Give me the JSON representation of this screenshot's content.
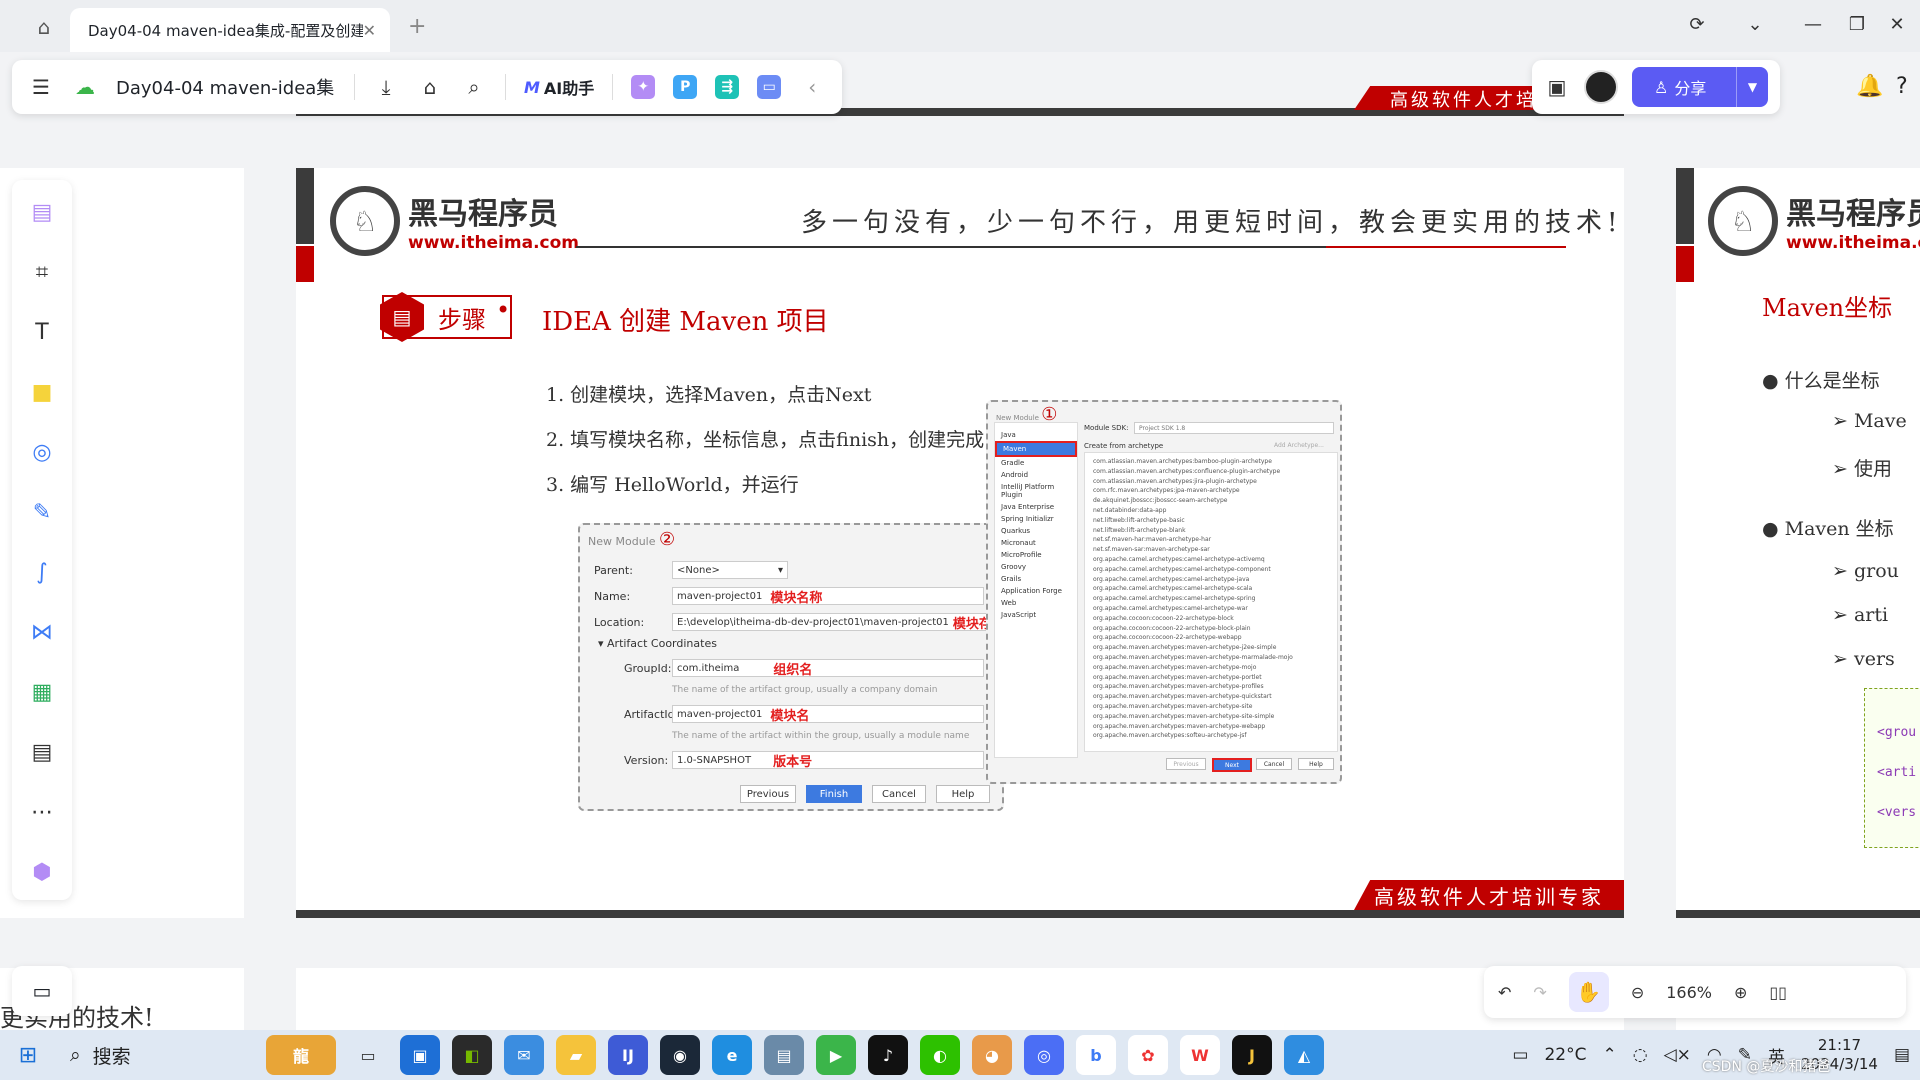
{
  "browser": {
    "tab_title": "Day04-04 maven-idea集成-配置及创建",
    "close_glyph": "✕",
    "new_tab_glyph": "+",
    "controls": [
      "⟳",
      "⌄",
      "—",
      "❐",
      "✕"
    ]
  },
  "toolbar": {
    "menu_glyph": "☰",
    "doc_title": "Day04-04 maven-idea集...",
    "ai_label": "AI助手",
    "collapse_glyph": "‹"
  },
  "right_toolbar": {
    "share_label": "分享"
  },
  "slide": {
    "logo_name": "黑马程序员",
    "logo_url": "www.itheima.com",
    "motto": "多一句没有，少一句不行，用更短时间，教会更实用的技术!",
    "step_label": "步骤",
    "heading": "IDEA 创建 Maven 项目",
    "bullet": "•",
    "steps": [
      "1.  创建模块，选择Maven，点击Next",
      "2.  填写模块名称，坐标信息，点击finish，创建完成",
      "3.  编写 HelloWorld，并运行"
    ],
    "footer": "高级软件人才培训专家"
  },
  "dialog2": {
    "title": "New Module",
    "number": "②",
    "parent_label": "Parent:",
    "parent_value": "<None>",
    "name_label": "Name:",
    "name_value": "maven-project01",
    "name_note": "模块名称",
    "location_label": "Location:",
    "location_value": "E:\\develop\\itheima-db-dev-project01\\maven-project01",
    "location_note": "模块存放路径",
    "section": "▾ Artifact Coordinates",
    "groupid_label": "GroupId:",
    "groupid_value": "com.itheima",
    "groupid_note": "组织名",
    "groupid_hint": "The name of the artifact group, usually a company domain",
    "artifactid_label": "ArtifactId:",
    "artifactid_value": "maven-project01",
    "artifactid_note": "模块名",
    "artifactid_hint": "The name of the artifact within the group, usually a module name",
    "version_label": "Version:",
    "version_value": "1.0-SNAPSHOT",
    "version_note": "版本号",
    "buttons": [
      "Previous",
      "Finish",
      "Cancel",
      "Help"
    ]
  },
  "dialog1": {
    "title": "New Module",
    "number": "①",
    "sdk_label": "Module SDK:",
    "sdk_value": "Project SDK 1.8",
    "archetype_checkbox": "Create from archetype",
    "add_archetype": "Add Archetype...",
    "side_items": [
      "Java",
      "Maven",
      "Gradle",
      "Android",
      "IntelliJ Platform Plugin",
      "Java Enterprise",
      "Spring Initializr",
      "Quarkus",
      "Micronaut",
      "MicroProfile",
      "Groovy",
      "Grails",
      "Application Forge",
      "Web",
      "JavaScript"
    ],
    "archetypes": [
      "com.atlassian.maven.archetypes:bamboo-plugin-archetype",
      "com.atlassian.maven.archetypes:confluence-plugin-archetype",
      "com.atlassian.maven.archetypes:jira-plugin-archetype",
      "com.rfc.maven.archetypes:jpa-maven-archetype",
      "de.akquinet.jbosscc:jbosscc-seam-archetype",
      "net.databinder:data-app",
      "net.liftweb:lift-archetype-basic",
      "net.liftweb:lift-archetype-blank",
      "net.sf.maven-har:maven-archetype-har",
      "net.sf.maven-sar:maven-archetype-sar",
      "org.apache.camel.archetypes:camel-archetype-activemq",
      "org.apache.camel.archetypes:camel-archetype-component",
      "org.apache.camel.archetypes:camel-archetype-java",
      "org.apache.camel.archetypes:camel-archetype-scala",
      "org.apache.camel.archetypes:camel-archetype-spring",
      "org.apache.camel.archetypes:camel-archetype-war",
      "org.apache.cocoon:cocoon-22-archetype-block",
      "org.apache.cocoon:cocoon-22-archetype-block-plain",
      "org.apache.cocoon:cocoon-22-archetype-webapp",
      "org.apache.maven.archetypes:maven-archetype-j2ee-simple",
      "org.apache.maven.archetypes:maven-archetype-marmalade-mojo",
      "org.apache.maven.archetypes:maven-archetype-mojo",
      "org.apache.maven.archetypes:maven-archetype-portlet",
      "org.apache.maven.archetypes:maven-archetype-profiles",
      "org.apache.maven.archetypes:maven-archetype-quickstart",
      "org.apache.maven.archetypes:maven-archetype-site",
      "org.apache.maven.archetypes:maven-archetype-site-simple",
      "org.apache.maven.archetypes:maven-archetype-webapp",
      "org.apache.maven.archetypes:softeu-archetype-jsf"
    ],
    "buttons": [
      "Previous",
      "Next",
      "Cancel",
      "Help"
    ]
  },
  "right_slide": {
    "logo_name": "黑马程序员",
    "logo_url": "www.itheima.com",
    "title": "Maven坐标",
    "items": [
      "●  什么是坐标",
      "➢  Mave",
      "➢  使用",
      "●  Maven 坐标",
      "➢  grou",
      "➢  arti",
      "➢  vers"
    ],
    "code": [
      "<grou",
      "<arti",
      "<vers"
    ]
  },
  "bottom_peek": {
    "left_text": "更实用的技术!"
  },
  "zoom": {
    "level": "166%"
  },
  "taskbar": {
    "search_label": "搜索",
    "weather": "22°C",
    "ime": "英",
    "time": "21:17",
    "date": "2024/3/14",
    "watermark": "CSDN @夏沙和猪爸"
  }
}
